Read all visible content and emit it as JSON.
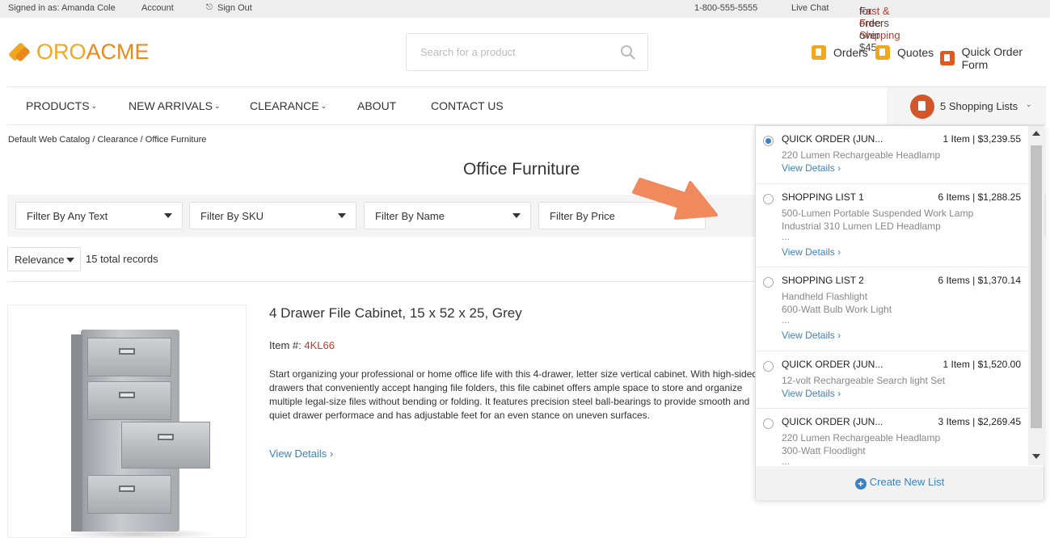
{
  "topbar": {
    "signed_in": "Signed in as: Amanda Cole",
    "account": "Account",
    "sign_out": "Sign Out",
    "sign_out_icon": "sign-out-icon",
    "phone": "1-800-555-5555",
    "live_chat": "Live Chat",
    "shipping_accent": "Fast & Free Shipping",
    "shipping_rest": " for orders over $45"
  },
  "header": {
    "logo_oro": "ORO",
    "logo_acme": "ACME",
    "search_placeholder": "Search for a product",
    "orders": "Orders",
    "quotes": "Quotes",
    "quick_order_form": "Quick Order Form"
  },
  "nav": {
    "items": [
      "PRODUCTS",
      "NEW ARRIVALS",
      "CLEARANCE",
      "ABOUT",
      "CONTACT US"
    ],
    "chevron": "⌄",
    "shopping_lists_label": "5 Shopping Lists"
  },
  "breadcrumb": "Default Web Catalog / Clearance / Office Furniture",
  "page_title": "Office Furniture",
  "filters": [
    "Filter By Any Text",
    "Filter By SKU",
    "Filter By Name",
    "Filter By Price"
  ],
  "sort": {
    "selected": "Relevance",
    "records": "15 total records"
  },
  "product": {
    "title": "4 Drawer File Cabinet, 15 x 52 x 25, Grey",
    "item_label": "Item #: ",
    "sku": "4KL66",
    "description": "Start organizing your professional or home office life with this 4-drawer, letter size vertical cabinet. With high-sided drawers that conveniently accept hanging file folders, this file cabinet offers ample space to store and organize multiple legal-size files without bending or folding. It features precision steel ball-bearings to provide smooth and quiet drawer performace and has adjustable feet for an even stance on uneven surfaces.",
    "view_details": "View Details ›"
  },
  "shopping_lists": {
    "items": [
      {
        "name": "QUICK ORDER (JUN...",
        "meta": "1 Item | $3,239.55",
        "lines": [
          "220 Lumen Rechargeable Headlamp"
        ],
        "more": "",
        "view": "View Details ›",
        "checked": true
      },
      {
        "name": "SHOPPING LIST 1",
        "meta": "6 Items | $1,288.25",
        "lines": [
          "500-Lumen Portable Suspended Work Lamp",
          "Industrial 310 Lumen LED Headlamp"
        ],
        "more": "...",
        "view": "View Details ›",
        "checked": false
      },
      {
        "name": "SHOPPING LIST 2",
        "meta": "6 Items | $1,370.14",
        "lines": [
          "Handheld Flashlight",
          "600-Watt Bulb Work Light"
        ],
        "more": "...",
        "view": "View Details ›",
        "checked": false
      },
      {
        "name": "QUICK ORDER (JUN...",
        "meta": "1 Item | $1,520.00",
        "lines": [
          "12-volt Rechargeable Search light Set"
        ],
        "more": "",
        "view": "View Details ›",
        "checked": false
      },
      {
        "name": "QUICK ORDER (JUN...",
        "meta": "3 Items | $2,269.45",
        "lines": [
          "220 Lumen Rechargeable Headlamp",
          "300-Watt Floodlight"
        ],
        "more": "...",
        "view": "",
        "checked": false
      }
    ],
    "create_new": "Create New List"
  },
  "colors": {
    "accent_orange": "#e8891a",
    "link_blue": "#3b82c4",
    "sku_red": "#c0392b",
    "arrow": "#f08a5d"
  }
}
